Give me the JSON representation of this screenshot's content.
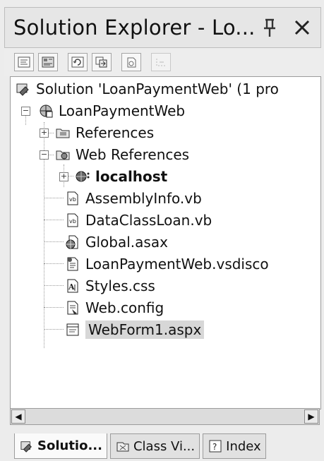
{
  "window": {
    "title": "Solution Explorer - Lo...",
    "pin_icon": "pin-icon",
    "close_icon": "close-icon"
  },
  "toolbar": {
    "buttons": [
      {
        "name": "view-code-icon"
      },
      {
        "name": "view-designer-icon"
      },
      {
        "name": "refresh-icon"
      },
      {
        "name": "copy-project-icon"
      },
      {
        "name": "show-all-files-icon"
      },
      {
        "name": "properties-icon"
      }
    ]
  },
  "tree": {
    "solution": "Solution 'LoanPaymentWeb' (1 pro",
    "project": "LoanPaymentWeb",
    "items": [
      {
        "label": "References",
        "icon": "references-icon"
      },
      {
        "label": "Web References",
        "icon": "web-references-icon"
      },
      {
        "label": "localhost",
        "icon": "globe-icon"
      },
      {
        "label": "AssemblyInfo.vb",
        "icon": "vb-file-icon"
      },
      {
        "label": "DataClassLoan.vb",
        "icon": "vb-file-icon"
      },
      {
        "label": "Global.asax",
        "icon": "global-asax-icon"
      },
      {
        "label": "LoanPaymentWeb.vsdisco",
        "icon": "disco-file-icon"
      },
      {
        "label": "Styles.css",
        "icon": "css-file-icon"
      },
      {
        "label": "Web.config",
        "icon": "config-file-icon"
      },
      {
        "label": "WebForm1.aspx",
        "icon": "aspx-file-icon"
      }
    ]
  },
  "tabs": [
    {
      "label": "Solutio...",
      "icon": "solution-icon"
    },
    {
      "label": "Class Vi...",
      "icon": "class-view-icon"
    },
    {
      "label": "Index",
      "icon": "help-index-icon"
    }
  ]
}
